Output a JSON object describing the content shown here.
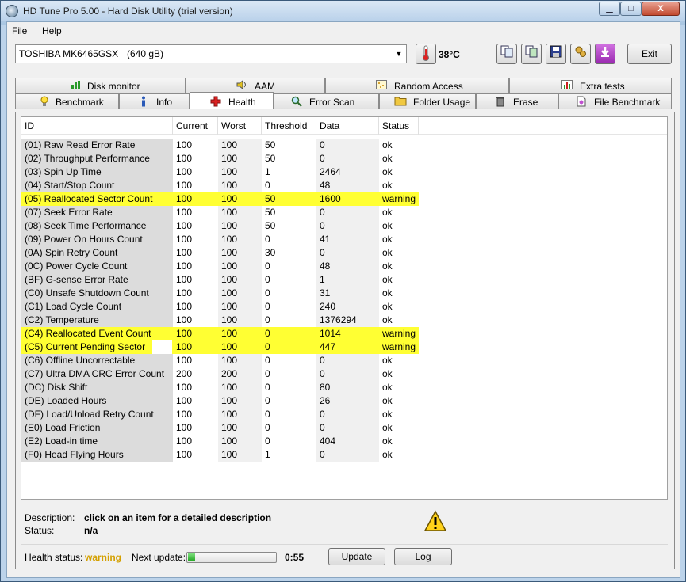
{
  "window": {
    "title": "HD Tune Pro 5.00 - Hard Disk Utility (trial version)",
    "min": "▁",
    "max": "□",
    "close": "X"
  },
  "menu": {
    "file": "File",
    "help": "Help"
  },
  "toolbar": {
    "drive_model": "TOSHIBA MK6465GSX",
    "drive_capacity": "(640 gB)",
    "temperature": "38°C",
    "exit_label": "Exit"
  },
  "tabs_top": [
    {
      "label": "Disk monitor",
      "icon": "chart-icon"
    },
    {
      "label": "AAM",
      "icon": "speaker-icon"
    },
    {
      "label": "Random Access",
      "icon": "scatter-icon"
    },
    {
      "label": "Extra tests",
      "icon": "chart-icon"
    }
  ],
  "tabs_bottom": [
    {
      "label": "Benchmark",
      "icon": "lightbulb-icon"
    },
    {
      "label": "Info",
      "icon": "info-icon"
    },
    {
      "label": "Health",
      "icon": "health-cross-icon"
    },
    {
      "label": "Error Scan",
      "icon": "magnifier-icon"
    },
    {
      "label": "Folder Usage",
      "icon": "folder-icon"
    },
    {
      "label": "Erase",
      "icon": "trash-icon"
    },
    {
      "label": "File Benchmark",
      "icon": "file-icon"
    }
  ],
  "active_tab": "Health",
  "table": {
    "columns": [
      "ID",
      "Current",
      "Worst",
      "Threshold",
      "Data",
      "Status"
    ],
    "rows": [
      [
        "(01) Raw Read Error Rate",
        "100",
        "100",
        "50",
        "0",
        "ok"
      ],
      [
        "(02) Throughput Performance",
        "100",
        "100",
        "50",
        "0",
        "ok"
      ],
      [
        "(03) Spin Up Time",
        "100",
        "100",
        "1",
        "2464",
        "ok"
      ],
      [
        "(04) Start/Stop Count",
        "100",
        "100",
        "0",
        "48",
        "ok"
      ],
      [
        "(05) Reallocated Sector Count",
        "100",
        "100",
        "50",
        "1600",
        "warning"
      ],
      [
        "(07) Seek Error Rate",
        "100",
        "100",
        "50",
        "0",
        "ok"
      ],
      [
        "(08) Seek Time Performance",
        "100",
        "100",
        "50",
        "0",
        "ok"
      ],
      [
        "(09) Power On Hours Count",
        "100",
        "100",
        "0",
        "41",
        "ok"
      ],
      [
        "(0A) Spin Retry Count",
        "100",
        "100",
        "30",
        "0",
        "ok"
      ],
      [
        "(0C) Power Cycle Count",
        "100",
        "100",
        "0",
        "48",
        "ok"
      ],
      [
        "(BF) G-sense Error Rate",
        "100",
        "100",
        "0",
        "1",
        "ok"
      ],
      [
        "(C0) Unsafe Shutdown Count",
        "100",
        "100",
        "0",
        "31",
        "ok"
      ],
      [
        "(C1) Load Cycle Count",
        "100",
        "100",
        "0",
        "240",
        "ok"
      ],
      [
        "(C2) Temperature",
        "100",
        "100",
        "0",
        "1376294",
        "ok"
      ],
      [
        "(C4) Reallocated Event Count",
        "100",
        "100",
        "0",
        "1014",
        "warning"
      ],
      [
        "(C5) Current Pending Sector",
        "100",
        "100",
        "0",
        "447",
        "warning"
      ],
      [
        "(C6) Offline Uncorrectable",
        "100",
        "100",
        "0",
        "0",
        "ok"
      ],
      [
        "(C7) Ultra DMA CRC Error Count",
        "200",
        "200",
        "0",
        "0",
        "ok"
      ],
      [
        "(DC) Disk Shift",
        "100",
        "100",
        "0",
        "80",
        "ok"
      ],
      [
        "(DE) Loaded Hours",
        "100",
        "100",
        "0",
        "26",
        "ok"
      ],
      [
        "(DF) Load/Unload Retry Count",
        "100",
        "100",
        "0",
        "0",
        "ok"
      ],
      [
        "(E0) Load Friction",
        "100",
        "100",
        "0",
        "0",
        "ok"
      ],
      [
        "(E2) Load-in time",
        "100",
        "100",
        "0",
        "404",
        "ok"
      ],
      [
        "(F0) Head Flying Hours",
        "100",
        "100",
        "1",
        "0",
        "ok"
      ]
    ]
  },
  "description": {
    "desc_label": "Description:",
    "desc_value": "click on an item for a detailed description",
    "status_label": "Status:",
    "status_value": "n/a"
  },
  "statusbar": {
    "health_label": "Health status:",
    "health_value": "warning",
    "next_update_label": "Next update:",
    "progress_fraction": 0.08,
    "countdown": "0:55",
    "update_button": "Update",
    "log_button": "Log"
  },
  "colors": {
    "warning_text": "#d4a000",
    "warning_row": "#ffff33"
  }
}
